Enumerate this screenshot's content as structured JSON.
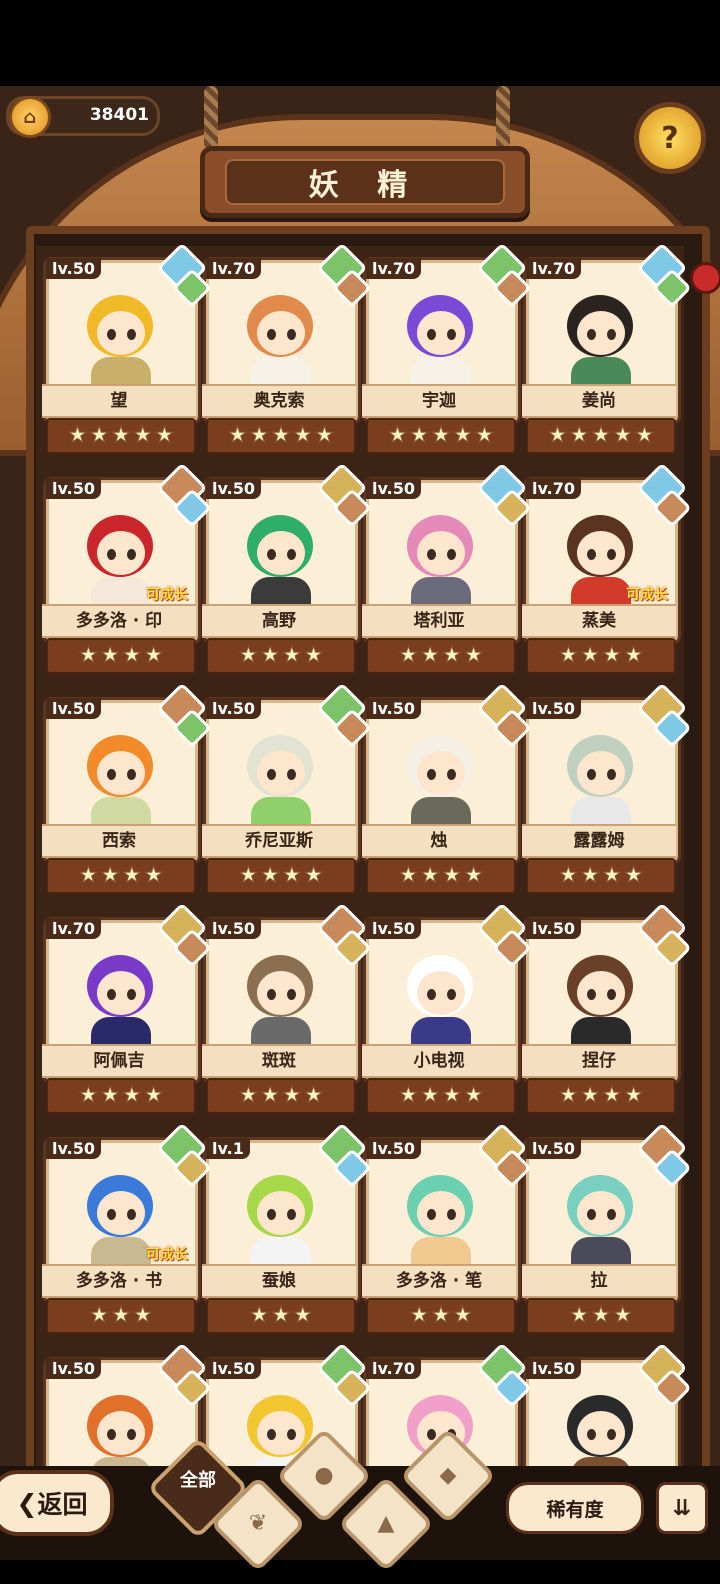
{
  "header": {
    "currency_value": "38401",
    "currency_icon": "coin-icon",
    "title": "妖 精",
    "help_icon": "question-sprout-icon"
  },
  "colors": {
    "water": "#7fc9e6",
    "grass": "#7cc36a",
    "earth": "#d6b25a",
    "rock": "#c88a5a",
    "star_bar": "#7a3e1f"
  },
  "cards": [
    {
      "level": "lv.50",
      "name": "望",
      "stars": 5,
      "elements": [
        "water",
        "grass"
      ],
      "grow": "",
      "hair": "#f1b928",
      "cloth": "#c9b06a"
    },
    {
      "level": "lv.70",
      "name": "奥克索",
      "stars": 5,
      "elements": [
        "grass",
        "rock"
      ],
      "grow": "",
      "hair": "#e08a4c",
      "cloth": "#f6f2e8"
    },
    {
      "level": "lv.70",
      "name": "宇迦",
      "stars": 5,
      "elements": [
        "grass",
        "rock"
      ],
      "grow": "",
      "hair": "#7a4ad6",
      "cloth": "#f6f2e8"
    },
    {
      "level": "lv.70",
      "name": "姜尚",
      "stars": 5,
      "elements": [
        "water",
        "grass"
      ],
      "grow": "",
      "hair": "#2b2320",
      "cloth": "#4a8a5a"
    },
    {
      "level": "lv.50",
      "name": "多多洛 · 印",
      "stars": 4,
      "elements": [
        "rock",
        "water"
      ],
      "grow": "可成长",
      "hair": "#c8262a",
      "cloth": "#f4e9d8"
    },
    {
      "level": "lv.50",
      "name": "高野",
      "stars": 4,
      "elements": [
        "earth",
        "rock"
      ],
      "grow": "",
      "hair": "#2fae6a",
      "cloth": "#3b3b3b"
    },
    {
      "level": "lv.50",
      "name": "塔利亚",
      "stars": 4,
      "elements": [
        "water",
        "earth"
      ],
      "grow": "",
      "hair": "#e58ab8",
      "cloth": "#6a6a7a"
    },
    {
      "level": "lv.70",
      "name": "蒸美",
      "stars": 4,
      "elements": [
        "water",
        "rock"
      ],
      "grow": "可成长",
      "hair": "#5a3420",
      "cloth": "#d23a2a"
    },
    {
      "level": "lv.50",
      "name": "西索",
      "stars": 4,
      "elements": [
        "rock",
        "grass"
      ],
      "grow": "",
      "hair": "#f28a2a",
      "cloth": "#cfd9a0"
    },
    {
      "level": "lv.50",
      "name": "乔尼亚斯",
      "stars": 4,
      "elements": [
        "grass",
        "rock"
      ],
      "grow": "",
      "hair": "#e3e3d3",
      "cloth": "#8fd06a"
    },
    {
      "level": "lv.50",
      "name": "烛",
      "stars": 4,
      "elements": [
        "earth",
        "rock"
      ],
      "grow": "",
      "hair": "#f4f0e6",
      "cloth": "#6a6a5a"
    },
    {
      "level": "lv.50",
      "name": "露露姆",
      "stars": 4,
      "elements": [
        "earth",
        "water"
      ],
      "grow": "",
      "hair": "#bfd0c0",
      "cloth": "#e8e8e8"
    },
    {
      "level": "lv.70",
      "name": "阿佩吉",
      "stars": 4,
      "elements": [
        "earth",
        "rock"
      ],
      "grow": "",
      "hair": "#7a3ac8",
      "cloth": "#2a2a6a"
    },
    {
      "level": "lv.50",
      "name": "斑斑",
      "stars": 4,
      "elements": [
        "rock",
        "earth"
      ],
      "grow": "",
      "hair": "#8a7050",
      "cloth": "#6a6a6a"
    },
    {
      "level": "lv.50",
      "name": "小电视",
      "stars": 4,
      "elements": [
        "earth",
        "rock"
      ],
      "grow": "",
      "hair": "#ffffff",
      "cloth": "#3a3a8a"
    },
    {
      "level": "lv.50",
      "name": "捏仔",
      "stars": 4,
      "elements": [
        "rock",
        "earth"
      ],
      "grow": "",
      "hair": "#6a4028",
      "cloth": "#2a2a2a"
    },
    {
      "level": "lv.50",
      "name": "多多洛 · 书",
      "stars": 3,
      "elements": [
        "grass",
        "earth"
      ],
      "grow": "可成长",
      "hair": "#3a7ad8",
      "cloth": "#c9b890"
    },
    {
      "level": "lv.1",
      "name": "蚕娘",
      "stars": 3,
      "elements": [
        "grass",
        "water"
      ],
      "grow": "",
      "hair": "#a6d84a",
      "cloth": "#f4f4f4"
    },
    {
      "level": "lv.50",
      "name": "多多洛 · 笔",
      "stars": 3,
      "elements": [
        "earth",
        "rock"
      ],
      "grow": "",
      "hair": "#6ad0b0",
      "cloth": "#f0c890"
    },
    {
      "level": "lv.50",
      "name": "拉",
      "stars": 3,
      "elements": [
        "rock",
        "water"
      ],
      "grow": "",
      "hair": "#7ad0c0",
      "cloth": "#4a4a5a"
    },
    {
      "level": "lv.50",
      "name": "",
      "stars": 0,
      "elements": [
        "rock",
        "earth"
      ],
      "grow": "",
      "hair": "#e0702a",
      "cloth": "#c9b890"
    },
    {
      "level": "lv.50",
      "name": "",
      "stars": 0,
      "elements": [
        "grass",
        "earth"
      ],
      "grow": "",
      "hair": "#f2c630",
      "cloth": "#f4f4f4"
    },
    {
      "level": "lv.70",
      "name": "",
      "stars": 0,
      "elements": [
        "grass",
        "water"
      ],
      "grow": "",
      "hair": "#f0a0c8",
      "cloth": "#f4f4f4"
    },
    {
      "level": "lv.50",
      "name": "",
      "stars": 0,
      "elements": [
        "earth",
        "rock"
      ],
      "grow": "",
      "hair": "#2a2a2a",
      "cloth": "#7a5030"
    }
  ],
  "bottom": {
    "back_label": "返回",
    "back_icon": "chevron-left-icon",
    "filter_all_label": "全部",
    "filter_icons": [
      "sprout-icon",
      "water-drop-icon",
      "mountain-icon",
      "rock-icon"
    ],
    "sort_label": "稀有度",
    "order_icon": "sort-order-icon"
  }
}
